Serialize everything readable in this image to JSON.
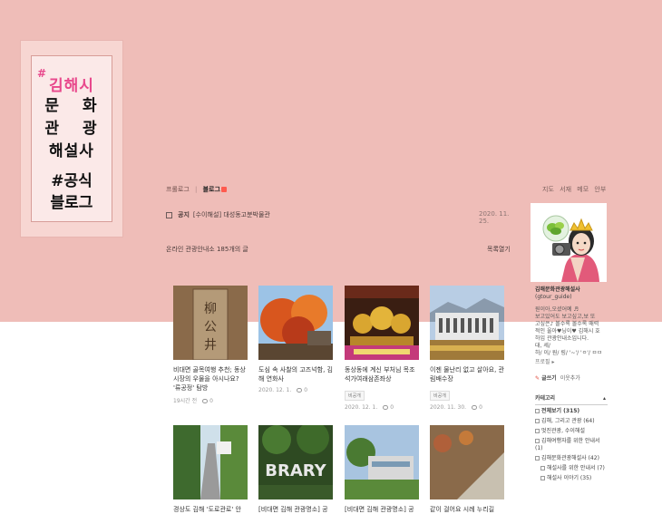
{
  "logo": {
    "hash": "#",
    "city": "김해시",
    "lines": [
      "문 화",
      "관 광",
      "해설사"
    ],
    "tag": [
      "#공식",
      "블로그"
    ]
  },
  "tabs": {
    "prologue": "프롤로그",
    "blog": "블로그"
  },
  "topmenu": [
    "지도",
    "서재",
    "메모",
    "안부"
  ],
  "notice": {
    "label": "공지",
    "title": "[수이해설] 대성동고분박물관",
    "date": "2020. 11. 25."
  },
  "count_text": "온라인 관광안내소 185개의 글",
  "list_open": "목록열기",
  "profile": {
    "name": "김해문화관광해설사",
    "id": "(gtour_guide)",
    "bio": [
      "원이아,오셨어예 ♬",
      "보고있어도 보고싶고,보 또",
      "고싶은♪ 볼수록 볼수록 매력",
      "적인 울아♥닝이♥ 김해시 호",
      "하입 관광안내소입니다.",
      "대, 세/",
      "하/ 이/ 원/ 링/ '~'/ 'ㅇ'/ ㅁㅁ"
    ],
    "more": "프로필 ▸",
    "write": "글쓰기",
    "neighbor": "이웃추가"
  },
  "category": {
    "heading": "카테고리",
    "items": [
      {
        "label": "전체보기 (315)",
        "bold": true,
        "sub": false
      },
      {
        "label": "김해, 그리고 관광 (64)",
        "bold": false,
        "sub": false
      },
      {
        "label": "멋진관광, 수이해설",
        "bold": false,
        "sub": false
      },
      {
        "label": "김해여행자를 위한 안내서 (1)",
        "bold": false,
        "sub": false
      },
      {
        "label": "김해문화관광해설사 (42)",
        "bold": false,
        "sub": false
      },
      {
        "label": "해설사를 위한 안내서 (7)",
        "bold": false,
        "sub": true
      },
      {
        "label": "해설사 이야기 (35)",
        "bold": false,
        "sub": true
      }
    ]
  },
  "posts": [
    {
      "title": "비대면 골목여행 추천; 동상시장의 우물을 아시나요? '류공정' 탐방",
      "meta": "19시간 전",
      "comments": "0",
      "tag": ""
    },
    {
      "title": "도심 속 사찰의 고즈넉함, 김해 연화사",
      "meta": "2020. 12. 1.",
      "comments": "0",
      "tag": ""
    },
    {
      "title": "동상동에 계신 부처님 목조석가여래삼존좌상",
      "meta": "2020. 12. 1.",
      "comments": "0",
      "tag": "비공개"
    },
    {
      "title": "이젠 물난리 없고 살아요, 관림배수장",
      "meta": "2020. 11. 30.",
      "comments": "0",
      "tag": "비공개"
    },
    {
      "title": "경상도 김해 '도로관로' 안",
      "meta": "",
      "comments": "",
      "tag": ""
    },
    {
      "title": "[비대면 김해 관광명소] 공",
      "meta": "",
      "comments": "",
      "tag": ""
    },
    {
      "title": "[비대면 김해 관광명소] 공",
      "meta": "",
      "comments": "",
      "tag": ""
    },
    {
      "title": "같이 걸어요 시례 누리길",
      "meta": "",
      "comments": "",
      "tag": ""
    }
  ],
  "colors": {
    "header_bg": "#efbdb8",
    "logo_pink": "#e8488c",
    "new_badge": "#ff5a4e"
  }
}
